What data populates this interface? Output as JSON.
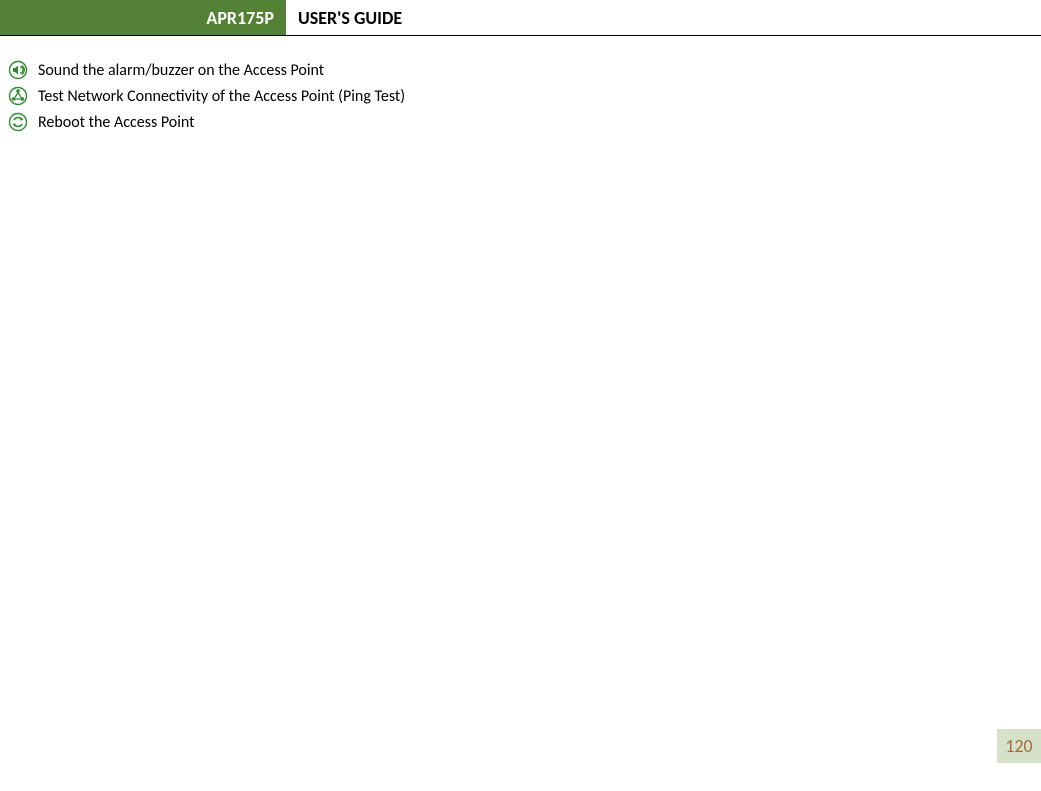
{
  "header": {
    "model": "APR175P",
    "title": "USER'S GUIDE"
  },
  "items": [
    {
      "icon": "sound-icon",
      "text": "Sound the alarm/buzzer on the Access Point"
    },
    {
      "icon": "network-icon",
      "text": "Test Network Connectivity of the Access Point (Ping Test)"
    },
    {
      "icon": "reboot-icon",
      "text": "Reboot the Access Point"
    }
  ],
  "page_number": "120",
  "colors": {
    "accent_green": "#2e8b2e",
    "header_bg": "#538135",
    "page_box_bg": "#d5e2c9",
    "page_number_color": "#a36b3a"
  }
}
